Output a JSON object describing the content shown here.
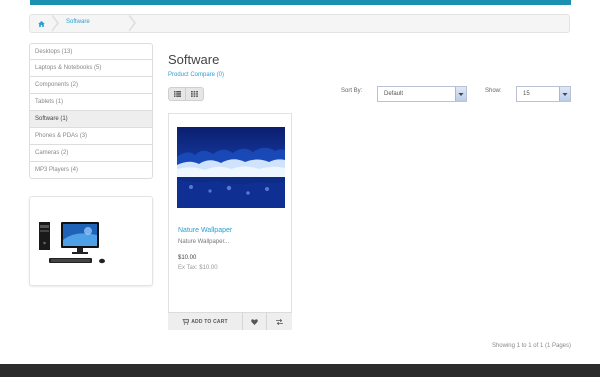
{
  "breadcrumb": {
    "home_icon": "home-icon",
    "current": "Software"
  },
  "sidebar": {
    "categories": [
      {
        "label": "Desktops (13)"
      },
      {
        "label": "Laptops & Notebooks (5)"
      },
      {
        "label": "Components (2)"
      },
      {
        "label": "Tablets (1)"
      },
      {
        "label": "Software (1)"
      },
      {
        "label": "Phones & PDAs (3)"
      },
      {
        "label": "Cameras (2)"
      },
      {
        "label": "MP3 Players (4)"
      }
    ],
    "active_index": 4
  },
  "main": {
    "title": "Software",
    "compare_link": "Product Compare (0)",
    "sort_label": "Sort By:",
    "sort_value": "Default",
    "show_label": "Show:",
    "show_value": "15"
  },
  "product": {
    "name": "Nature Wallpaper",
    "description": "Nature Wallpaper...",
    "price": "$10.00",
    "ex_tax": "Ex Tax: $10.00",
    "add_to_cart_label": "ADD TO CART"
  },
  "pagination": {
    "text": "Showing 1 to 1 of 1 (1 Pages)"
  },
  "colors": {
    "accent": "#1c90b0",
    "link": "#2a9fd6",
    "footer": "#2b2b2b"
  }
}
